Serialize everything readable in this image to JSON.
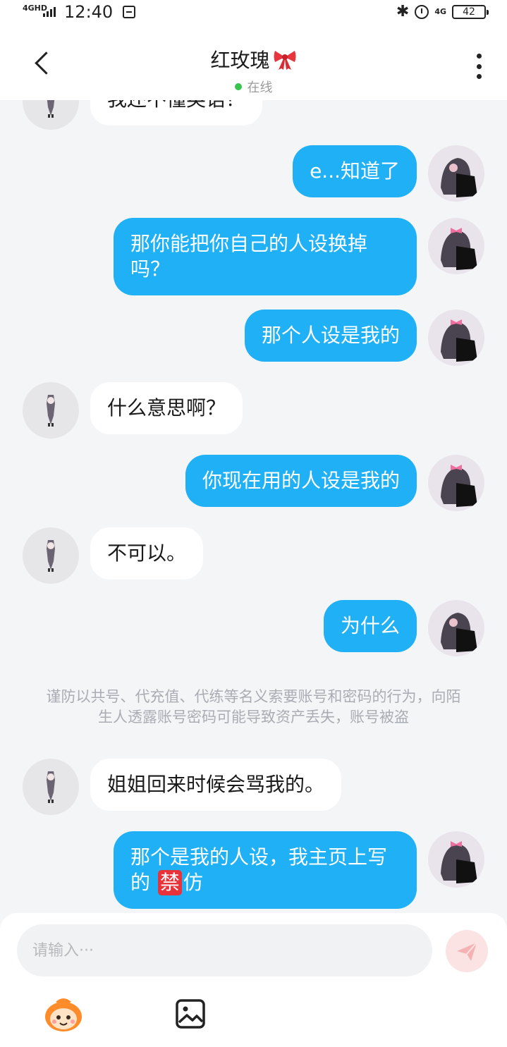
{
  "status_bar": {
    "network_label": "4GHD",
    "time": "12:40",
    "network_4g": "4G",
    "battery": "42"
  },
  "header": {
    "title": "红玫瑰",
    "online_status": "在线",
    "online_color": "#37c54e"
  },
  "messages": [
    {
      "side": "left",
      "text": "我还不懂英语？"
    },
    {
      "side": "right",
      "text": "e...知道了"
    },
    {
      "side": "right",
      "text": "那你能把你自己的人设换掉吗？"
    },
    {
      "side": "right",
      "text": "那个人设是我的"
    },
    {
      "side": "left",
      "text": "什么意思啊？"
    },
    {
      "side": "right",
      "text": "你现在用的人设是我的"
    },
    {
      "side": "left",
      "text": "不可以。"
    },
    {
      "side": "right",
      "text": "为什么"
    },
    {
      "side": "left",
      "text": "姐姐回来时候会骂我的。"
    },
    {
      "side": "right",
      "text_before": "那个是我的人设，我主页上写的 ",
      "emoji": "禁",
      "text_after": "仿"
    }
  ],
  "notice": "谨防以共号、代充值、代练等名义索要账号和密码的行为，向陌生人透露账号密码可能导致资产丢失，账号被盗",
  "input": {
    "placeholder": "请输入···",
    "value": ""
  },
  "colors": {
    "bubble_mine": "#1fb0f5",
    "bubble_other": "#ffffff",
    "background": "#f4f5f7",
    "send_button": "#fce3e3"
  },
  "icons": {
    "back": "back-arrow-icon",
    "more": "more-vertical-icon",
    "send": "send-icon",
    "emoji": "emoji-mascot-icon",
    "image": "image-icon"
  }
}
